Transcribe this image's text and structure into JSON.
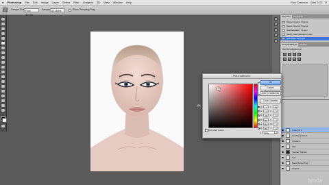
{
  "menubar": {
    "items": [
      "Photoshop",
      "File",
      "Edit",
      "Image",
      "Layer",
      "Select",
      "Filter",
      "Analysis",
      "3D",
      "View",
      "Window",
      "Help"
    ],
    "right": [
      "Rick Sammon",
      "Wed 3:00",
      "Q"
    ]
  },
  "options": {
    "sample_size_label": "Sample Size:",
    "sample_size_value": "Point Sample",
    "sample_label": "Sample:",
    "sample_value": "All Layers",
    "show_ring_label": "Show Sampling Ring"
  },
  "history": {
    "tabs": [
      "HISTORY",
      "ACTIONS"
    ],
    "items": [
      {
        "label": "Master Opacity Change"
      },
      {
        "label": "Master Opacity Change"
      },
      {
        "label": "Hue/Saturation 1 Layer"
      },
      {
        "label": "Modify Hue/Saturation Layer"
      },
      {
        "label": "New Color Fill Layer",
        "selected": true
      }
    ]
  },
  "adjustments": {
    "tabs": [
      "ADJUSTMENTS",
      "MASKS"
    ],
    "title": "Add an adjustment"
  },
  "layers": {
    "rows": [
      {
        "name": "Color Fill 1",
        "selected": true
      },
      {
        "name": "Hue/Saturation 1"
      },
      {
        "name": "Curves 1"
      },
      {
        "name": "Skin"
      },
      {
        "name": "Internal Shadow"
      },
      {
        "name": "Hair"
      },
      {
        "name": "Basic Retouching"
      },
      {
        "name": "Original"
      }
    ]
  },
  "picker": {
    "title": "Pick a solid color:",
    "ok": "OK",
    "cancel": "Cancel",
    "add_swatches": "Add To Swatches",
    "color_libraries": "Color Libraries",
    "current_label": "current",
    "web_only": "Only Web Colors",
    "fields": {
      "H": "0",
      "S": "0",
      "B": "98",
      "R": "250",
      "G": "250",
      "Bv": "250",
      "L": "98",
      "a": "0",
      "b": "0",
      "C": "1",
      "M": "1",
      "Y": "1",
      "K": "0"
    },
    "hex": "fafafa"
  },
  "watermark": "lynda"
}
